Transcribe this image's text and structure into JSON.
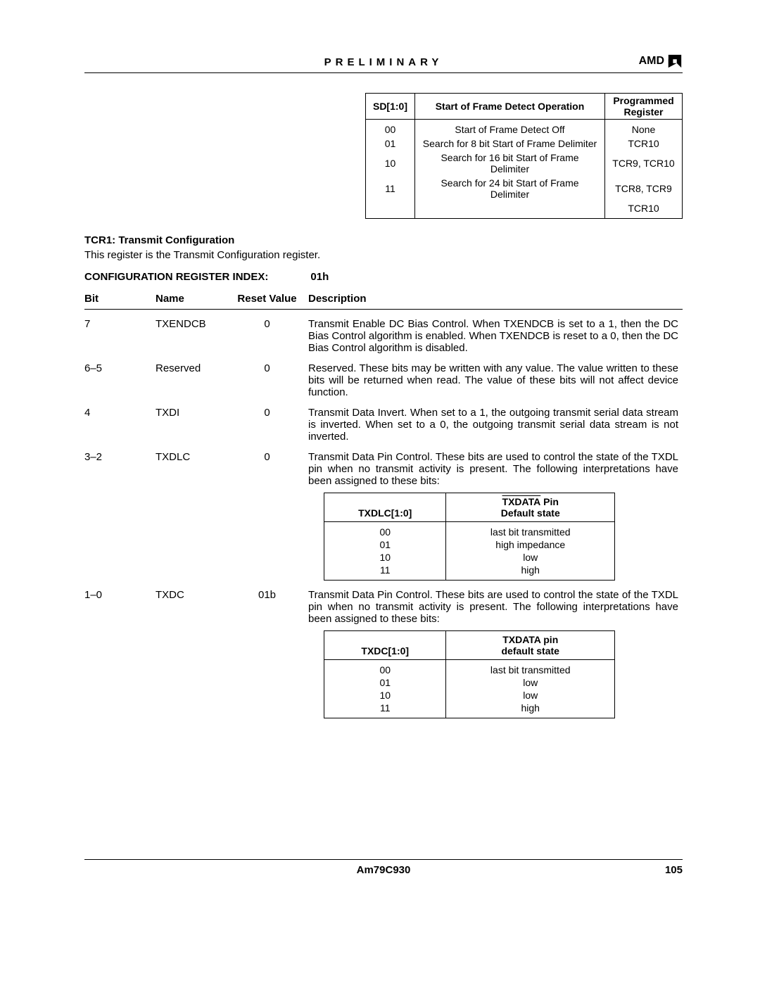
{
  "header": {
    "preliminary": "PRELIMINARY",
    "brand": "AMD"
  },
  "table_sd": {
    "head": {
      "c1": "SD[1:0]",
      "c2": "Start of Frame Detect Operation",
      "c3a": "Programmed",
      "c3b": "Register"
    },
    "rows": [
      {
        "c1": "00",
        "c2": "Start of Frame Detect Off",
        "c3": "None"
      },
      {
        "c1": "01",
        "c2": "Search for 8 bit Start of Frame Delimiter",
        "c3": "TCR10"
      },
      {
        "c1": "10",
        "c2": "Search for 16 bit Start of Frame Delimiter",
        "c3": "TCR9, TCR10"
      },
      {
        "c1": "11",
        "c2": "Search for 24 bit Start of Frame Delimiter",
        "c3": "TCR8, TCR9"
      },
      {
        "c1": "",
        "c2": "",
        "c3": "TCR10"
      }
    ]
  },
  "section": {
    "title": "TCR1: Transmit Configuration",
    "body": "This register is the Transmit Configuration register.",
    "cri_label": "CONFIGURATION REGISTER INDEX:",
    "cri_value": "01h"
  },
  "bits_head": {
    "bit": "Bit",
    "name": "Name",
    "reset": "Reset Value",
    "desc": "Description"
  },
  "bits": [
    {
      "bit": "7",
      "name": "TXENDCB",
      "reset": "0",
      "desc": "Transmit Enable DC Bias Control. When TXENDCB is set to a 1, then the DC Bias Control algorithm is enabled. When TXENDCB is reset to a 0, then the DC Bias Control algorithm is disabled."
    },
    {
      "bit": "6–5",
      "name": "Reserved",
      "reset": "0",
      "desc": "Reserved. These bits may be written with any value. The value written to these bits will be returned when read. The value of these bits will not affect device function."
    },
    {
      "bit": "4",
      "name": "TXDI",
      "reset": "0",
      "desc": "Transmit Data Invert. When set to a 1, the outgoing transmit serial data stream is inverted. When set to a 0, the outgoing transmit serial data stream is not inverted."
    },
    {
      "bit": "3–2",
      "name": "TXDLC",
      "reset": "0",
      "desc": "Transmit Data Pin Control. These bits are used to control the state of the TXDL pin when no transmit activity is present. The following interpretations have been assigned to these bits:"
    },
    {
      "bit": "1–0",
      "name": "TXDC",
      "reset": "01b",
      "desc": "Transmit Data Pin Control. These bits are used to control the state of the TXDL pin when no transmit activity is present. The following interpretations have been assigned to these bits:"
    }
  ],
  "inner_txdlc": {
    "h1": "TXDLC[1:0]",
    "h2_over": "TXDATA",
    "h2_plain": " Pin",
    "h2b": "Default state",
    "rows": [
      {
        "c1": "00",
        "c2": "last bit transmitted"
      },
      {
        "c1": "01",
        "c2": "high impedance"
      },
      {
        "c1": "10",
        "c2": "low"
      },
      {
        "c1": "11",
        "c2": "high"
      }
    ]
  },
  "inner_txdc": {
    "h1": "TXDC[1:0]",
    "h2a": "TXDATA pin",
    "h2b": "default state",
    "rows": [
      {
        "c1": "00",
        "c2": "last bit transmitted"
      },
      {
        "c1": "01",
        "c2": "low"
      },
      {
        "c1": "10",
        "c2": "low"
      },
      {
        "c1": "11",
        "c2": "high"
      }
    ]
  },
  "footer": {
    "part": "Am79C930",
    "page": "105"
  }
}
